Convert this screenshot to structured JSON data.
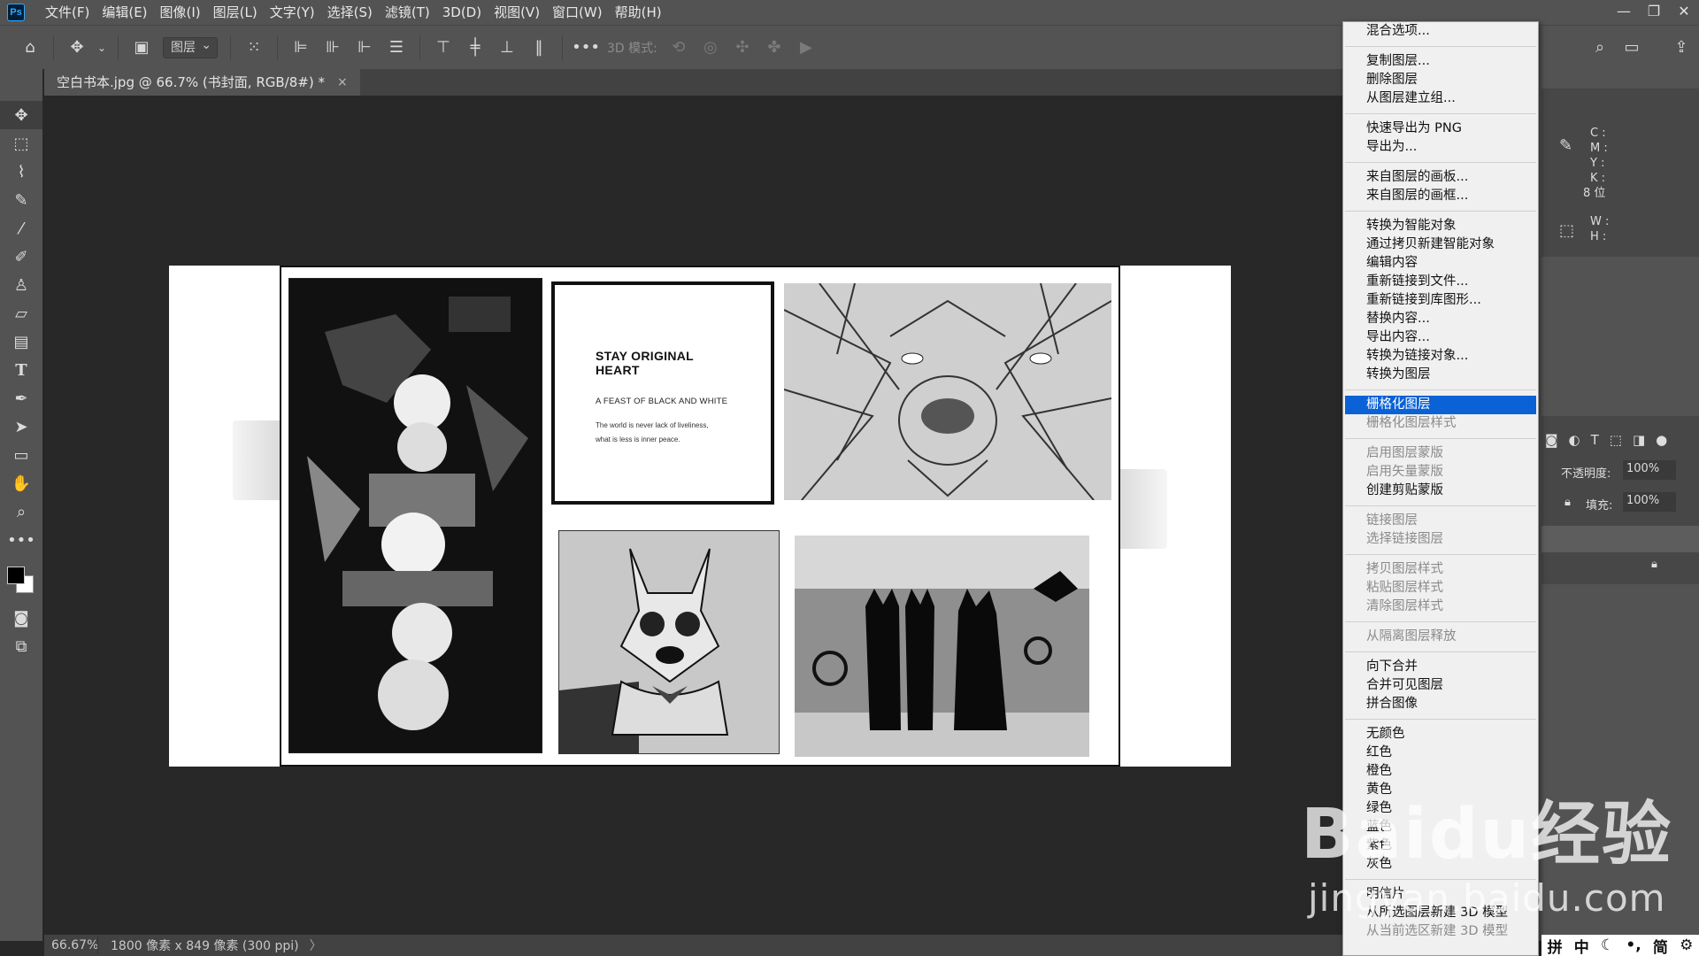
{
  "app": {
    "logo": "Ps"
  },
  "menubar": {
    "items": [
      "文件(F)",
      "编辑(E)",
      "图像(I)",
      "图层(L)",
      "文字(Y)",
      "选择(S)",
      "滤镜(T)",
      "3D(D)",
      "视图(V)",
      "窗口(W)",
      "帮助(H)"
    ]
  },
  "options": {
    "layer_select": "图层",
    "mode_3d_label": "3D 模式:"
  },
  "tab": {
    "title": "空白书本.jpg @ 66.7% (书封面, RGB/8#) *",
    "close": "×"
  },
  "canvas": {
    "card_title": "STAY ORIGINAL HEART",
    "card_sub": "A FEAST OF BLACK AND WHITE",
    "card_line1": "The world is never lack of liveliness,",
    "card_line2": "what is less is inner peace."
  },
  "status": {
    "zoom": "66.67%",
    "info": "1800 像素 x 849 像素 (300 ppi)",
    "arrow": "〉"
  },
  "context_menu": {
    "items": [
      {
        "label": "混合选项...",
        "state": "normal"
      },
      {
        "sep": true
      },
      {
        "label": "复制图层...",
        "state": "normal"
      },
      {
        "label": "删除图层",
        "state": "normal"
      },
      {
        "label": "从图层建立组...",
        "state": "normal"
      },
      {
        "sep": true
      },
      {
        "label": "快速导出为 PNG",
        "state": "normal"
      },
      {
        "label": "导出为...",
        "state": "normal"
      },
      {
        "sep": true
      },
      {
        "label": "来自图层的画板...",
        "state": "normal"
      },
      {
        "label": "来自图层的画框...",
        "state": "normal"
      },
      {
        "sep": true
      },
      {
        "label": "转换为智能对象",
        "state": "normal"
      },
      {
        "label": "通过拷贝新建智能对象",
        "state": "normal"
      },
      {
        "label": "编辑内容",
        "state": "normal"
      },
      {
        "label": "重新链接到文件...",
        "state": "normal"
      },
      {
        "label": "重新链接到库图形...",
        "state": "normal"
      },
      {
        "label": "替换内容...",
        "state": "normal"
      },
      {
        "label": "导出内容...",
        "state": "normal"
      },
      {
        "label": "转换为链接对象...",
        "state": "normal"
      },
      {
        "label": "转换为图层",
        "state": "normal"
      },
      {
        "sep": true
      },
      {
        "label": "栅格化图层",
        "state": "highlight"
      },
      {
        "label": "栅格化图层样式",
        "state": "disabled"
      },
      {
        "sep": true
      },
      {
        "label": "启用图层蒙版",
        "state": "disabled"
      },
      {
        "label": "启用矢量蒙版",
        "state": "disabled"
      },
      {
        "label": "创建剪贴蒙版",
        "state": "normal"
      },
      {
        "sep": true
      },
      {
        "label": "链接图层",
        "state": "disabled"
      },
      {
        "label": "选择链接图层",
        "state": "disabled"
      },
      {
        "sep": true
      },
      {
        "label": "拷贝图层样式",
        "state": "disabled"
      },
      {
        "label": "粘贴图层样式",
        "state": "disabled"
      },
      {
        "label": "清除图层样式",
        "state": "disabled"
      },
      {
        "sep": true
      },
      {
        "label": "从隔离图层释放",
        "state": "disabled"
      },
      {
        "sep": true
      },
      {
        "label": "向下合并",
        "state": "normal"
      },
      {
        "label": "合并可见图层",
        "state": "normal"
      },
      {
        "label": "拼合图像",
        "state": "normal"
      },
      {
        "sep": true
      },
      {
        "label": "无颜色",
        "state": "normal"
      },
      {
        "label": "红色",
        "state": "normal"
      },
      {
        "label": "橙色",
        "state": "normal"
      },
      {
        "label": "黄色",
        "state": "normal"
      },
      {
        "label": "绿色",
        "state": "normal"
      },
      {
        "label": "蓝色",
        "state": "normal"
      },
      {
        "label": "紫色",
        "state": "normal"
      },
      {
        "label": "灰色",
        "state": "normal"
      },
      {
        "sep": true
      },
      {
        "label": "明信片",
        "state": "normal"
      },
      {
        "label": "从所选图层新建 3D 模型",
        "state": "normal"
      },
      {
        "label": "从当前选区新建 3D 模型",
        "state": "disabled"
      }
    ]
  },
  "right_panel": {
    "cmyk": [
      "C :",
      "M :",
      "Y :",
      "K :"
    ],
    "bits": "8 位",
    "wh": [
      "W :",
      "H :"
    ],
    "opacity_label": "不透明度:",
    "opacity_value": "100%",
    "fill_label": "填充:",
    "fill_value": "100%"
  },
  "ime": [
    "拼",
    "中",
    "简"
  ],
  "watermark": {
    "main": "Baidu经验",
    "sub": "jingyan.baidu.com"
  }
}
